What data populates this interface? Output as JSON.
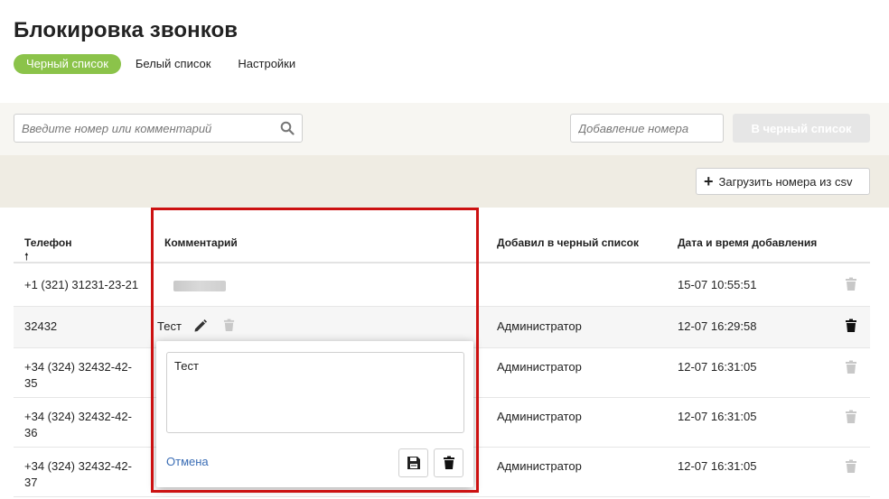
{
  "page": {
    "title": "Блокировка звонков"
  },
  "tabs": [
    {
      "label": "Черный список",
      "active": true
    },
    {
      "label": "Белый список",
      "active": false
    },
    {
      "label": "Настройки",
      "active": false
    }
  ],
  "toolbar": {
    "search_placeholder": "Введите номер или комментарий",
    "add_placeholder": "Добавление номера",
    "add_button": "В черный список"
  },
  "csv": {
    "label": "Загрузить номера из csv"
  },
  "table": {
    "columns": [
      "Телефон",
      "Комментарий",
      "Добавил в черный список",
      "Дата и время добавления"
    ],
    "sort_arrow": "🠕",
    "rows": [
      {
        "phone": "+1 (321) 31231-23-21",
        "comment": "",
        "added_by": "",
        "datetime": "15-07 10:55:51"
      },
      {
        "phone": "32432",
        "comment": "Тест",
        "added_by": "Администратор",
        "datetime": "12-07 16:29:58"
      },
      {
        "phone": "+34 (324) 32432-42-35",
        "comment": "",
        "added_by": "Администратор",
        "datetime": "12-07 16:31:05"
      },
      {
        "phone": "+34 (324) 32432-42-36",
        "comment": "",
        "added_by": "Администратор",
        "datetime": "12-07 16:31:05"
      },
      {
        "phone": "+34 (324) 32432-42-37",
        "comment": "",
        "added_by": "Администратор",
        "datetime": "12-07 16:31:05"
      }
    ]
  },
  "editor": {
    "text": "Тест",
    "cancel": "Отмена"
  },
  "colors": {
    "accent": "#8bc34a",
    "highlight": "#cc1111",
    "link": "#3a6db5"
  }
}
